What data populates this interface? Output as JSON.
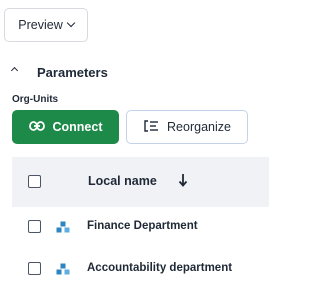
{
  "toolbar": {
    "preview_label": "Preview"
  },
  "parameters": {
    "title": "Parameters"
  },
  "org_units": {
    "label": "Org-Units",
    "connect_label": "Connect",
    "reorganize_label": "Reorganize"
  },
  "table": {
    "column_header": "Local name",
    "rows": [
      {
        "name": "Finance Department"
      },
      {
        "name": "Accountability department"
      }
    ]
  },
  "colors": {
    "accent_green": "#1e8a4a",
    "org_icon": "#2e86c1",
    "header_bg": "#f0f2f5"
  },
  "icons": [
    "chevron-down-icon",
    "chevron-up-icon",
    "link-icon",
    "reorganize-icon",
    "arrow-down-icon",
    "org-unit-icon"
  ]
}
